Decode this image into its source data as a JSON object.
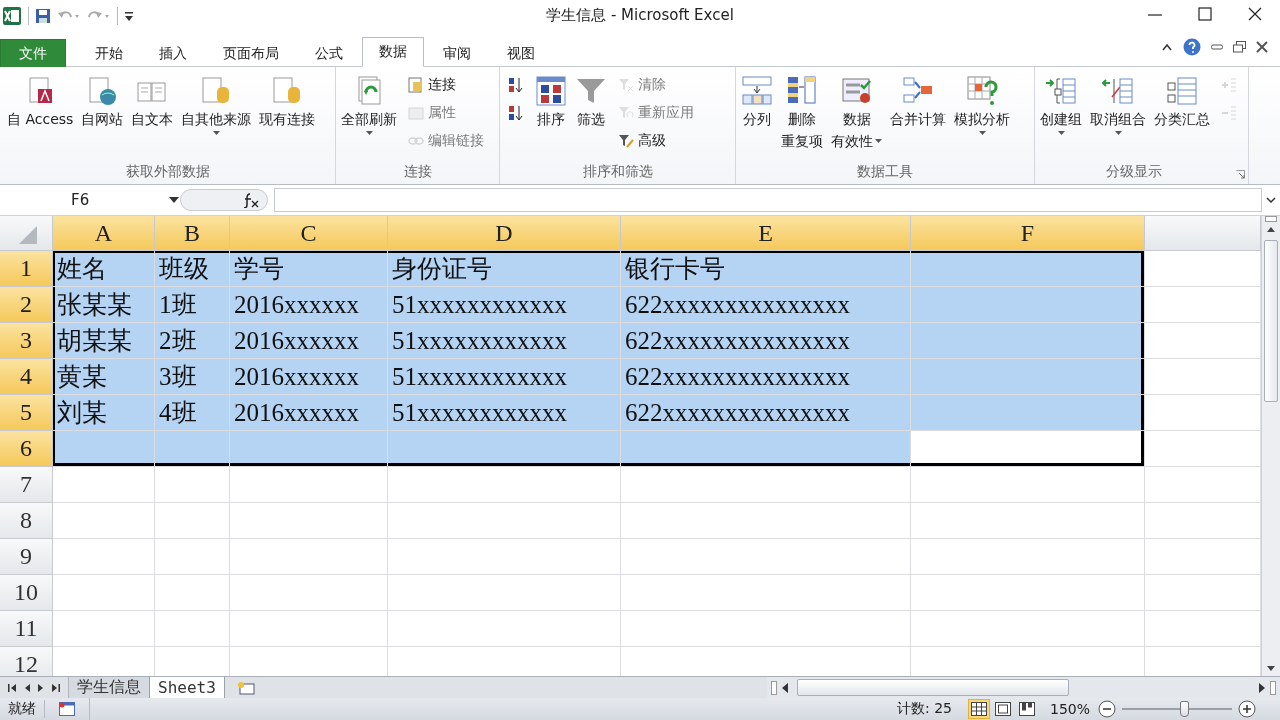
{
  "window": {
    "title": "学生信息 - Microsoft Excel"
  },
  "ribbon": {
    "tabs": [
      {
        "label": "文件",
        "kind": "file",
        "selected": false
      },
      {
        "label": "开始",
        "kind": "tab",
        "selected": false
      },
      {
        "label": "插入",
        "kind": "tab",
        "selected": false
      },
      {
        "label": "页面布局",
        "kind": "tab",
        "selected": false
      },
      {
        "label": "公式",
        "kind": "tab",
        "selected": false
      },
      {
        "label": "数据",
        "kind": "tab",
        "selected": true
      },
      {
        "label": "审阅",
        "kind": "tab",
        "selected": false
      },
      {
        "label": "视图",
        "kind": "tab",
        "selected": false
      }
    ],
    "groups": [
      {
        "label": "获取外部数据",
        "items": [
          {
            "kind": "large",
            "lines": [
              "自 Access"
            ]
          },
          {
            "kind": "large",
            "lines": [
              "自网站"
            ]
          },
          {
            "kind": "large",
            "lines": [
              "自文本"
            ]
          },
          {
            "kind": "large",
            "lines": [
              "自其他来源"
            ],
            "dropdown": true
          },
          {
            "kind": "large",
            "lines": [
              "现有连接"
            ]
          }
        ]
      },
      {
        "label": "连接",
        "items": [
          {
            "kind": "large",
            "lines": [
              "全部刷新"
            ],
            "dropdown": true
          },
          {
            "kind": "stack",
            "items": [
              {
                "label": "连接",
                "disabled": false
              },
              {
                "label": "属性",
                "disabled": true
              },
              {
                "label": "编辑链接",
                "disabled": true
              }
            ]
          }
        ]
      },
      {
        "label": "排序和筛选",
        "items": [
          {
            "kind": "stack",
            "items": [
              {
                "disabled": false
              },
              {
                "disabled": false
              }
            ]
          },
          {
            "kind": "large",
            "lines": [
              "排序"
            ]
          },
          {
            "kind": "large",
            "lines": [
              "筛选"
            ]
          },
          {
            "kind": "stack",
            "items": [
              {
                "label": "清除",
                "disabled": true
              },
              {
                "label": "重新应用",
                "disabled": true
              },
              {
                "label": "高级",
                "disabled": false
              }
            ]
          }
        ]
      },
      {
        "label": "数据工具",
        "items": [
          {
            "kind": "large",
            "lines": [
              "分列"
            ]
          },
          {
            "kind": "large",
            "lines": [
              "删除",
              "重复项"
            ]
          },
          {
            "kind": "large",
            "lines": [
              "数据",
              "有效性"
            ],
            "dropdown": true
          },
          {
            "kind": "large",
            "lines": [
              "合并计算"
            ]
          },
          {
            "kind": "large",
            "lines": [
              "模拟分析"
            ],
            "dropdown": true
          }
        ]
      },
      {
        "label": "分级显示",
        "launcher": true,
        "items": [
          {
            "kind": "large",
            "lines": [
              "创建组"
            ],
            "dropdown": true
          },
          {
            "kind": "large",
            "lines": [
              "取消组合"
            ],
            "dropdown": true
          },
          {
            "kind": "large",
            "lines": [
              "分类汇总"
            ]
          },
          {
            "kind": "stack",
            "items": [
              {
                "disabled": true
              },
              {
                "disabled": true
              }
            ]
          }
        ]
      }
    ]
  },
  "formula_bar": {
    "name_box": "F6"
  },
  "grid": {
    "columns": [
      {
        "label": "A",
        "selected": true
      },
      {
        "label": "B",
        "selected": true
      },
      {
        "label": "C",
        "selected": true
      },
      {
        "label": "D",
        "selected": true
      },
      {
        "label": "E",
        "selected": true
      },
      {
        "label": "F",
        "selected": true
      }
    ],
    "rows": [
      {
        "header": "1",
        "selected": true,
        "cells": [
          {
            "text": "姓名",
            "selected": true
          },
          {
            "text": "班级",
            "selected": true
          },
          {
            "text": "学号",
            "selected": true
          },
          {
            "text": "身份证号",
            "selected": true
          },
          {
            "text": "银行卡号",
            "selected": true
          },
          {
            "selected": true
          }
        ]
      },
      {
        "header": "2",
        "selected": true,
        "cells": [
          {
            "text": "张某某",
            "selected": true
          },
          {
            "text": "1班",
            "selected": true
          },
          {
            "text": "2016xxxxxx",
            "selected": true
          },
          {
            "text": "51xxxxxxxxxxxx",
            "selected": true
          },
          {
            "text": "622xxxxxxxxxxxxxxx",
            "selected": true
          },
          {
            "selected": true
          }
        ]
      },
      {
        "header": "3",
        "selected": true,
        "cells": [
          {
            "text": "胡某某",
            "selected": true
          },
          {
            "text": "2班",
            "selected": true
          },
          {
            "text": "2016xxxxxx",
            "selected": true
          },
          {
            "text": "51xxxxxxxxxxxx",
            "selected": true
          },
          {
            "text": "622xxxxxxxxxxxxxxx",
            "selected": true
          },
          {
            "selected": true
          }
        ]
      },
      {
        "header": "4",
        "selected": true,
        "cells": [
          {
            "text": "黄某",
            "selected": true
          },
          {
            "text": "3班",
            "selected": true
          },
          {
            "text": "2016xxxxxx",
            "selected": true
          },
          {
            "text": "51xxxxxxxxxxxx",
            "selected": true
          },
          {
            "text": "622xxxxxxxxxxxxxxx",
            "selected": true
          },
          {
            "selected": true
          }
        ]
      },
      {
        "header": "5",
        "selected": true,
        "cells": [
          {
            "text": "刘某",
            "selected": true
          },
          {
            "text": "4班",
            "selected": true
          },
          {
            "text": "2016xxxxxx",
            "selected": true
          },
          {
            "text": "51xxxxxxxxxxxx",
            "selected": true
          },
          {
            "text": "622xxxxxxxxxxxxxxx",
            "selected": true
          },
          {
            "selected": true
          }
        ]
      },
      {
        "header": "6",
        "selected": true,
        "cells": [
          {
            "selected": true
          },
          {
            "selected": true
          },
          {
            "selected": true
          },
          {
            "selected": true
          },
          {
            "selected": true
          },
          {
            "selected": false
          }
        ]
      },
      {
        "header": "7",
        "selected": false,
        "cells": [
          {
            "selected": false
          },
          {
            "selected": false
          },
          {
            "selected": false
          },
          {
            "selected": false
          },
          {
            "selected": false
          },
          {
            "selected": false
          }
        ]
      },
      {
        "header": "8",
        "selected": false,
        "cells": [
          {
            "selected": false
          },
          {
            "selected": false
          },
          {
            "selected": false
          },
          {
            "selected": false
          },
          {
            "selected": false
          },
          {
            "selected": false
          }
        ]
      },
      {
        "header": "9",
        "selected": false,
        "cells": [
          {
            "selected": false
          },
          {
            "selected": false
          },
          {
            "selected": false
          },
          {
            "selected": false
          },
          {
            "selected": false
          },
          {
            "selected": false
          }
        ]
      },
      {
        "header": "10",
        "selected": false,
        "cells": [
          {
            "selected": false
          },
          {
            "selected": false
          },
          {
            "selected": false
          },
          {
            "selected": false
          },
          {
            "selected": false
          },
          {
            "selected": false
          }
        ]
      },
      {
        "header": "11",
        "selected": false,
        "cells": [
          {
            "selected": false
          },
          {
            "selected": false
          },
          {
            "selected": false
          },
          {
            "selected": false
          },
          {
            "selected": false
          },
          {
            "selected": false
          }
        ]
      },
      {
        "header": "12",
        "selected": false,
        "cells": [
          {
            "selected": false
          },
          {
            "selected": false
          },
          {
            "selected": false
          },
          {
            "selected": false
          },
          {
            "selected": false
          },
          {
            "selected": false
          }
        ]
      }
    ]
  },
  "sheet_tabs": [
    {
      "label": "学生信息",
      "selected": false
    },
    {
      "label": "Sheet3",
      "selected": true
    }
  ],
  "status_bar": {
    "status": "就绪",
    "count": "计数: 25",
    "views": [
      {
        "selected": true
      },
      {
        "selected": false
      },
      {
        "selected": false
      }
    ],
    "zoom": "150%",
    "zoom_slider": {
      "level": 0.57
    }
  }
}
